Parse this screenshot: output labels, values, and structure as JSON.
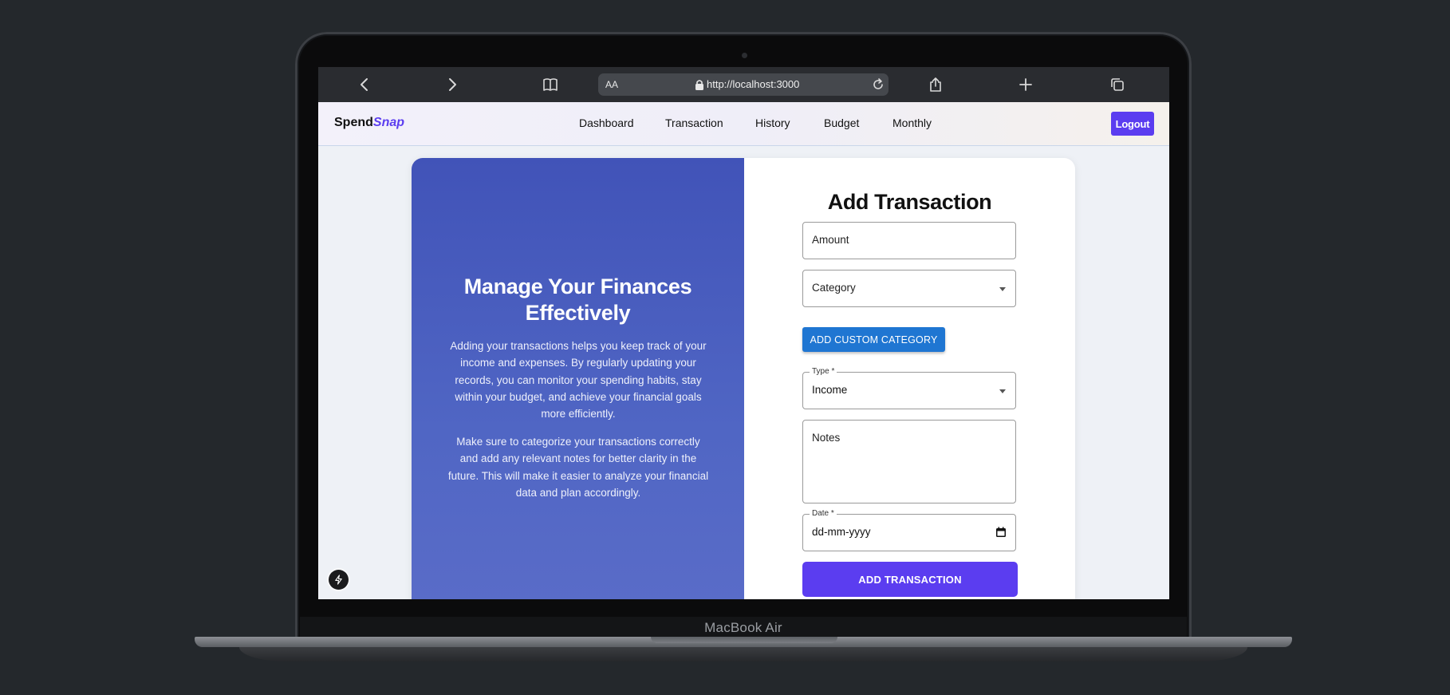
{
  "browser": {
    "reader_label": "AA",
    "url": "http://localhost:3000"
  },
  "app": {
    "logo_part1": "Spend",
    "logo_part2": "Snap",
    "nav": [
      "Dashboard",
      "Transaction",
      "History",
      "Budget",
      "Monthly"
    ],
    "logout_label": "Logout"
  },
  "info_panel": {
    "title": "Manage Your Finances Effectively",
    "paragraph1": "Adding your transactions helps you keep track of your income and expenses. By regularly updating your records, you can monitor your spending habits, stay within your budget, and achieve your financial goals more efficiently.",
    "paragraph2": "Make sure to categorize your transactions correctly and add any relevant notes for better clarity in the future. This will make it easier to analyze your financial data and plan accordingly."
  },
  "form": {
    "title": "Add Transaction",
    "amount_placeholder": "Amount",
    "category_placeholder": "Category",
    "custom_category_button": "ADD CUSTOM CATEGORY",
    "type_label": "Type *",
    "type_value": "Income",
    "notes_placeholder": "Notes",
    "date_label": "Date *",
    "date_placeholder": "dd-mm-yyyy",
    "submit_button": "ADD TRANSACTION"
  },
  "device": {
    "model_label": "MacBook Air"
  },
  "colors": {
    "accent": "#5b3df0",
    "custom_button": "#1f76d2",
    "panel": "#4a5ebf",
    "backdrop": "#24282c"
  }
}
